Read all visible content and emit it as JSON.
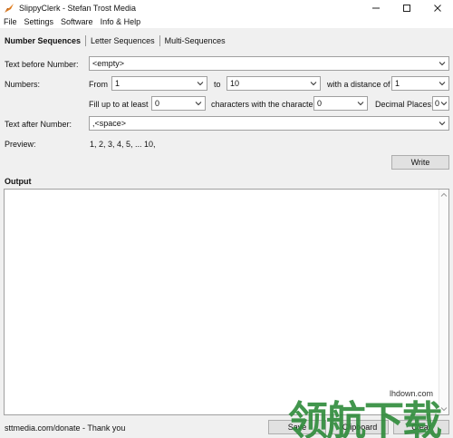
{
  "window": {
    "title": "SlippyClerk - Stefan Trost Media"
  },
  "menu": [
    "File",
    "Settings",
    "Software",
    "Info & Help"
  ],
  "tabs": [
    "Number Sequences",
    "Letter Sequences",
    "Multi-Sequences"
  ],
  "form": {
    "text_before_label": "Text before Number:",
    "text_before_value": "<empty>",
    "numbers_label": "Numbers:",
    "from_label": "From",
    "from_value": "1",
    "to_label": "to",
    "to_value": "10",
    "distance_label": "with a distance of",
    "distance_value": "1",
    "fill_label": "Fill up to at least",
    "fill_value": "0",
    "character_label": "characters with the character",
    "character_value": "0",
    "decimal_label": "Decimal Places:",
    "decimal_value": "0",
    "text_after_label": "Text after Number:",
    "text_after_value": ",<space>",
    "preview_label": "Preview:",
    "preview_value": "1, 2, 3, 4, 5, ... 10,"
  },
  "buttons": {
    "write": "Write",
    "save": "Save",
    "clipboard": "Clipboard",
    "clear": "Clear"
  },
  "output": {
    "label": "Output"
  },
  "status": {
    "text": "sttmedia.com/donate - Thank you"
  },
  "watermark": {
    "logo_text": "领航下载",
    "url": "lhdown.com"
  },
  "icons": {
    "app": "slippyclerk-app-icon",
    "minimize": "minimize-icon",
    "maximize": "maximize-icon",
    "close": "close-icon",
    "dropdown": "chevron-down-icon"
  }
}
